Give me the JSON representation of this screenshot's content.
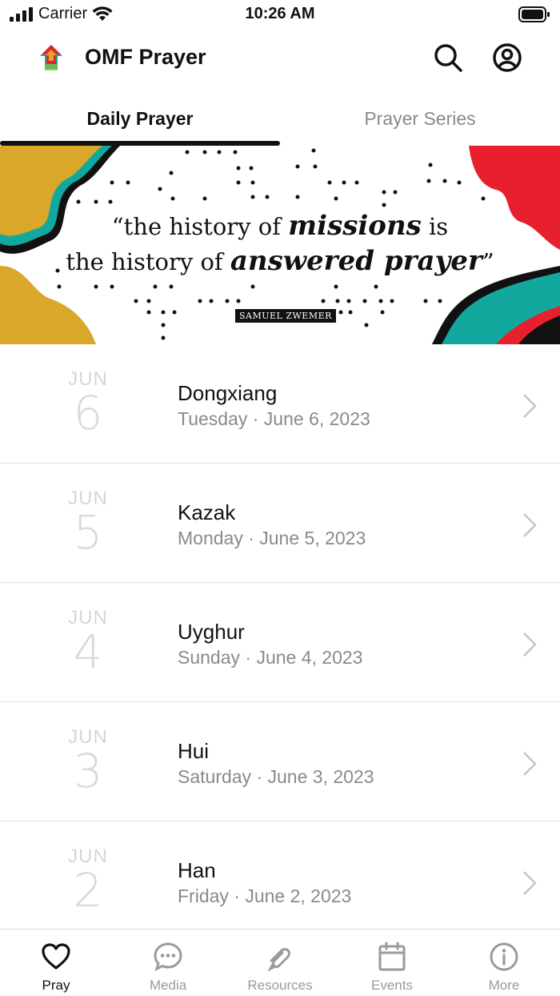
{
  "status_bar": {
    "carrier": "Carrier",
    "time": "10:26 AM"
  },
  "app": {
    "title": "OMF Prayer"
  },
  "tabs": [
    {
      "label": "Daily Prayer",
      "active": true
    },
    {
      "label": "Prayer Series",
      "active": false
    }
  ],
  "banner": {
    "line1_pre": "the history of ",
    "line1_em": "missions",
    "line1_post": " is",
    "line2_pre": "the history of ",
    "line2_em": "answered prayer",
    "author": "SAMUEL ZWEMER"
  },
  "prayers": [
    {
      "month": "JUN",
      "day": "6",
      "title": "Dongxiang",
      "subtitle": "Tuesday · June 6, 2023"
    },
    {
      "month": "JUN",
      "day": "5",
      "title": "Kazak",
      "subtitle": "Monday · June 5, 2023"
    },
    {
      "month": "JUN",
      "day": "4",
      "title": "Uyghur",
      "subtitle": "Sunday · June 4, 2023"
    },
    {
      "month": "JUN",
      "day": "3",
      "title": "Hui",
      "subtitle": "Saturday · June 3, 2023"
    },
    {
      "month": "JUN",
      "day": "2",
      "title": "Han",
      "subtitle": "Friday · June 2, 2023"
    }
  ],
  "nav": [
    {
      "label": "Pray",
      "icon": "heart-icon",
      "active": true
    },
    {
      "label": "Media",
      "icon": "chat-bubble-icon",
      "active": false
    },
    {
      "label": "Resources",
      "icon": "resources-icon",
      "active": false
    },
    {
      "label": "Events",
      "icon": "calendar-icon",
      "active": false
    },
    {
      "label": "More",
      "icon": "info-icon",
      "active": false
    }
  ],
  "colors": {
    "accent_red": "#e8202e",
    "teal": "#13a89e",
    "mustard": "#d9a82b",
    "inactive": "#9a9a9a"
  }
}
